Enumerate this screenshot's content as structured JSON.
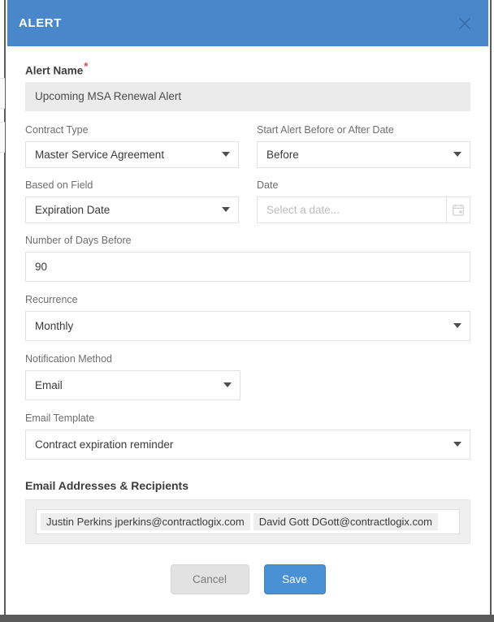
{
  "modal": {
    "title": "ALERT",
    "close_icon": "close-icon"
  },
  "form": {
    "alert_name": {
      "label": "Alert Name",
      "required_marker": "*",
      "value": "Upcoming MSA Renewal Alert"
    },
    "contract_type": {
      "label": "Contract Type",
      "value": "Master Service Agreement"
    },
    "start_alert": {
      "label": "Start Alert Before or After Date",
      "value": "Before"
    },
    "based_on_field": {
      "label": "Based on Field",
      "value": "Expiration Date"
    },
    "date": {
      "label": "Date",
      "value": "",
      "placeholder": "Select a date...",
      "icon": "calendar-icon"
    },
    "days_before": {
      "label": "Number of Days Before",
      "value": "90"
    },
    "recurrence": {
      "label": "Recurrence",
      "value": "Monthly"
    },
    "notification_method": {
      "label": "Notification Method",
      "value": "Email"
    },
    "email_template": {
      "label": "Email Template",
      "value": "Contract expiration reminder"
    }
  },
  "recipients": {
    "title": "Email Addresses & Recipients",
    "chips": [
      "Justin Perkins jperkins@contractlogix.com",
      "David Gott DGott@contractlogix.com"
    ]
  },
  "footer": {
    "cancel_label": "Cancel",
    "save_label": "Save"
  },
  "colors": {
    "header_blue": "#4a86ca",
    "save_blue": "#4a90d4",
    "required_red": "#d0454c",
    "bottom_bar": "#5a5a5a"
  }
}
